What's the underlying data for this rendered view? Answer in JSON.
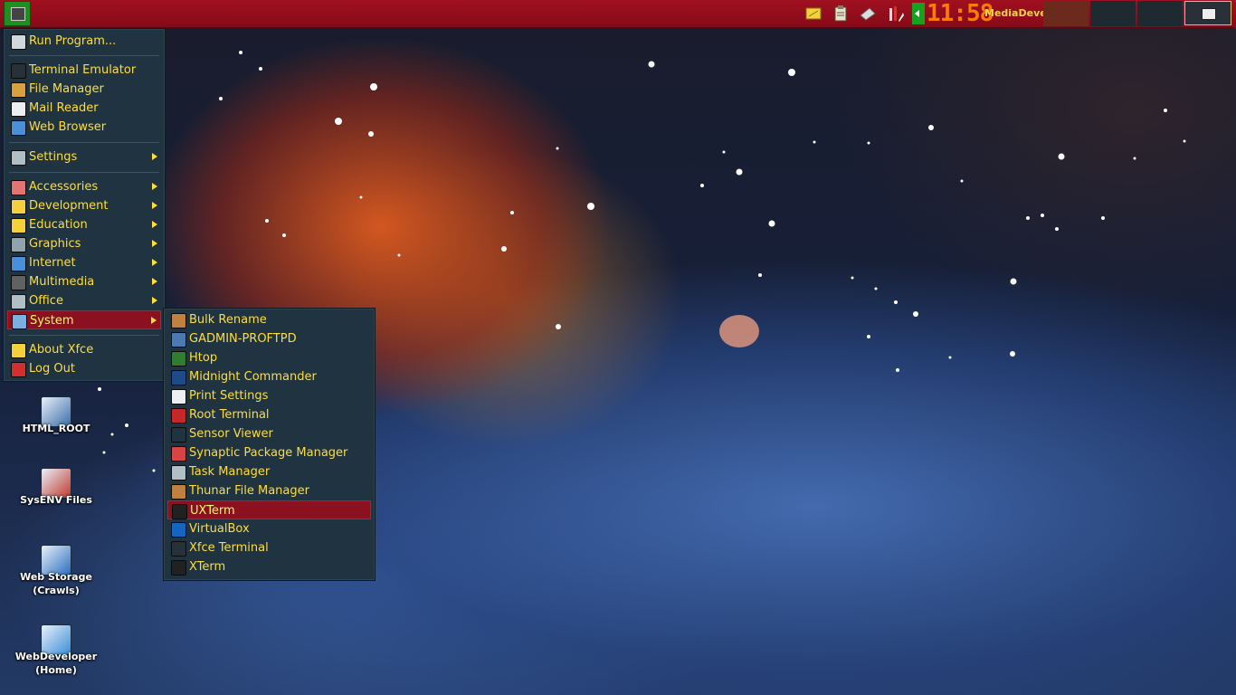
{
  "panel": {
    "clock": "11:58",
    "workspace": "MediaDevel",
    "tray_icons": [
      "notes-icon",
      "clipboard-icon",
      "mount-icon",
      "tools-icon"
    ]
  },
  "main_menu": {
    "items": [
      {
        "label": "Run Program...",
        "icon": "run-icon",
        "submenu": false
      },
      {
        "label": "Terminal Emulator",
        "icon": "terminal-icon",
        "submenu": false
      },
      {
        "label": "File Manager",
        "icon": "file-manager-icon",
        "submenu": false
      },
      {
        "label": "Mail Reader",
        "icon": "mail-icon",
        "submenu": false
      },
      {
        "label": "Web Browser",
        "icon": "globe-icon",
        "submenu": false
      },
      {
        "label": "Settings",
        "icon": "settings-icon",
        "submenu": true
      },
      {
        "label": "Accessories",
        "icon": "accessories-icon",
        "submenu": true
      },
      {
        "label": "Development",
        "icon": "development-icon",
        "submenu": true
      },
      {
        "label": "Education",
        "icon": "education-icon",
        "submenu": true
      },
      {
        "label": "Graphics",
        "icon": "graphics-icon",
        "submenu": true
      },
      {
        "label": "Internet",
        "icon": "internet-icon",
        "submenu": true
      },
      {
        "label": "Multimedia",
        "icon": "multimedia-icon",
        "submenu": true
      },
      {
        "label": "Office",
        "icon": "office-icon",
        "submenu": true
      },
      {
        "label": "System",
        "icon": "system-icon",
        "submenu": true,
        "active": true
      },
      {
        "label": "About Xfce",
        "icon": "about-icon",
        "submenu": false
      },
      {
        "label": "Log Out",
        "icon": "logout-icon",
        "submenu": false
      }
    ]
  },
  "system_menu": {
    "items": [
      {
        "label": "Bulk Rename",
        "icon": "bulk-rename-icon"
      },
      {
        "label": "GADMIN-PROFTPD",
        "icon": "gadmin-icon"
      },
      {
        "label": "Htop",
        "icon": "htop-icon"
      },
      {
        "label": "Midnight Commander",
        "icon": "mc-icon"
      },
      {
        "label": "Print Settings",
        "icon": "printer-icon"
      },
      {
        "label": "Root Terminal",
        "icon": "root-terminal-icon"
      },
      {
        "label": "Sensor Viewer",
        "icon": "sensor-icon"
      },
      {
        "label": "Synaptic Package Manager",
        "icon": "synaptic-icon"
      },
      {
        "label": "Task Manager",
        "icon": "task-manager-icon"
      },
      {
        "label": "Thunar File Manager",
        "icon": "thunar-icon"
      },
      {
        "label": "UXTerm",
        "icon": "uxterm-icon",
        "active": true
      },
      {
        "label": "VirtualBox",
        "icon": "virtualbox-icon"
      },
      {
        "label": "Xfce Terminal",
        "icon": "xfce-terminal-icon"
      },
      {
        "label": "XTerm",
        "icon": "xterm-icon"
      }
    ]
  },
  "desktop_icons": [
    {
      "label": "HTML_ROOT",
      "icon": "folder-network-icon"
    },
    {
      "label": "SysENV Files",
      "icon": "blocks-icon"
    },
    {
      "label": "Web Storage (Crawls)",
      "icon": "network-storage-icon"
    },
    {
      "label": "WebDeveloper\n(Home)",
      "icon": "developer-home-icon"
    }
  ],
  "colors": {
    "panel": "#960d1c",
    "menu_bg": "#1f3340",
    "menu_text": "#ffde3a",
    "highlight": "#8b1020",
    "clock": "#ff7a00"
  }
}
